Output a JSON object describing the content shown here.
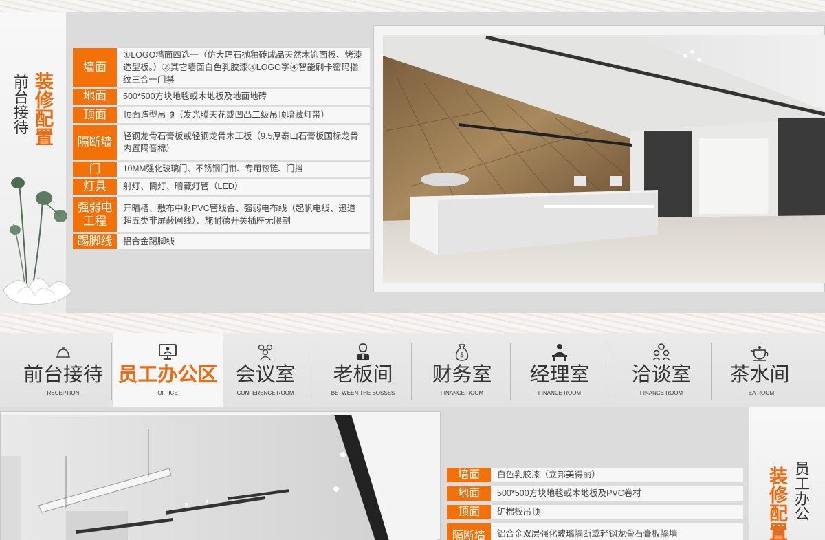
{
  "section1": {
    "title_orange": [
      "装",
      "修",
      "配",
      "置"
    ],
    "title_dark": [
      "前",
      "台",
      "接",
      "待"
    ],
    "rows": [
      {
        "label": "墙面",
        "value": "①LOGO墙面四选一（仿大理石抛釉砖成品天然木饰面板、烤漆造型板。）②其它墙面白色乳胶漆③LOGO字④智能刷卡密码指纹三合一门禁"
      },
      {
        "label": "地面",
        "value": "500*500方块地毯或木地板及地面地砖"
      },
      {
        "label": "顶面",
        "value": "顶面造型吊顶（发光膜天花或凹凸二级吊顶暗藏灯带）"
      },
      {
        "label": "隔断墙",
        "value": "轻钢龙骨石膏板或轻钢龙骨木工板（9.5厚泰山石膏板国标龙骨内置隔音棉）"
      },
      {
        "label": "门",
        "value": "10MM强化玻璃门、不锈钢门锁、专用铰链、门挡"
      },
      {
        "label": "灯具",
        "value": "射灯、筒灯、暗藏灯管（LED）"
      },
      {
        "label": "强弱电工程",
        "value": "开暗槽、敷布中财PVC管线合、强弱电布线（起帆电线、迅道超五类非屏蔽网线）、施耐德开关插座无限制"
      },
      {
        "label": "踢脚线",
        "value": "铝合金踢脚线"
      }
    ]
  },
  "nav": {
    "active_color": "#f06a0f",
    "items": [
      {
        "title": "前台接待",
        "sub": "RECEPTION",
        "icon": "reception-bell-icon"
      },
      {
        "title": "员工办公区",
        "sub": "OFFICE",
        "icon": "computer-monitor-icon"
      },
      {
        "title": "会议室",
        "sub": "CONFERENCE ROOM",
        "icon": "people-group-icon"
      },
      {
        "title": "老板间",
        "sub": "BETWEEN THE BOSSES",
        "icon": "boss-person-icon"
      },
      {
        "title": "财务室",
        "sub": "FINANCE ROOM",
        "icon": "money-bag-icon"
      },
      {
        "title": "经理室",
        "sub": "FINANCE ROOM",
        "icon": "manager-desk-icon"
      },
      {
        "title": "洽谈室",
        "sub": "FINANCE ROOM",
        "icon": "negotiation-icon"
      },
      {
        "title": "茶水间",
        "sub": "TEA ROOM",
        "icon": "teapot-icon"
      }
    ]
  },
  "section2": {
    "title_orange": [
      "装",
      "修",
      "配",
      "置"
    ],
    "title_dark": [
      "员",
      "工",
      "办",
      "公"
    ],
    "rows": [
      {
        "label": "墙面",
        "value": "白色乳胶漆（立邦美得丽）"
      },
      {
        "label": "地面",
        "value": "500*500方块地毯或木地板及PVC卷材"
      },
      {
        "label": "顶面",
        "value": "矿棉板吊顶"
      },
      {
        "label": "隔断墙",
        "value": "铝合金双层强化玻璃隔断或轻钢龙骨石膏板隔墙"
      }
    ]
  },
  "colors": {
    "accent": "#f27108",
    "label_text": "#ffffff"
  }
}
